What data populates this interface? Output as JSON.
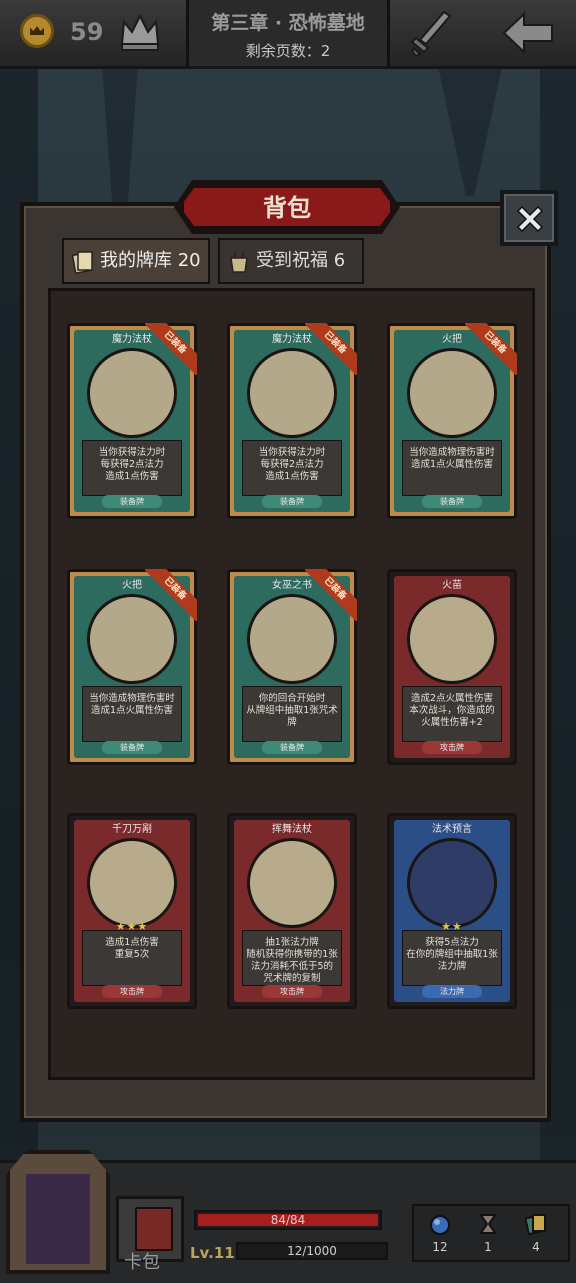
{
  "topbar": {
    "gold": "59",
    "chapter_title": "第三章 · 恐怖墓地",
    "pages_left": "剩余页数：2"
  },
  "modal": {
    "title": "背包",
    "tabs": [
      {
        "label": "我的牌库",
        "count": "20",
        "active": true
      },
      {
        "label": "受到祝福",
        "count": "6",
        "active": false
      }
    ]
  },
  "cards": [
    {
      "name": "魔力法杖",
      "desc": "当你获得法力时\n每获得2点法力\n造成1点伤害",
      "type": "装备牌",
      "equipped": "已装备",
      "color": "green"
    },
    {
      "name": "魔力法杖",
      "desc": "当你获得法力时\n每获得2点法力\n造成1点伤害",
      "type": "装备牌",
      "equipped": "已装备",
      "color": "green"
    },
    {
      "name": "火把",
      "desc": "当你造成物理伤害时\n造成1点火属性伤害",
      "type": "装备牌",
      "equipped": "已装备",
      "color": "green"
    },
    {
      "name": "火把",
      "desc": "当你造成物理伤害时\n造成1点火属性伤害",
      "type": "装备牌",
      "equipped": "已装备",
      "color": "green"
    },
    {
      "name": "女巫之书",
      "desc": "你的回合开始时\n从牌组中抽取1张咒术牌",
      "type": "装备牌",
      "equipped": "已装备",
      "color": "green"
    },
    {
      "name": "火苗",
      "desc": "造成2点火属性伤害\n本次战斗，你造成的\n火属性伤害+2",
      "type": "攻击牌",
      "equipped": "",
      "color": "red"
    },
    {
      "name": "千刀万剐",
      "desc": "造成1点伤害\n重复5次",
      "type": "攻击牌",
      "equipped": "",
      "color": "red",
      "stars": "★★★"
    },
    {
      "name": "挥舞法杖",
      "desc": "抽1张法力牌\n随机获得你携带的1张\n法力消耗不低于5的\n咒术牌的复制",
      "type": "攻击牌",
      "equipped": "",
      "color": "red"
    },
    {
      "name": "法术预言",
      "desc": "获得5点法力\n在你的牌组中抽取1张\n法力牌",
      "type": "法力牌",
      "equipped": "",
      "color": "blue",
      "stars": "★★"
    }
  ],
  "player": {
    "hp": "84/84",
    "hp_fraction": 1.0,
    "level": "Lv.11",
    "xp": "12/1000",
    "xp_fraction": 0.012,
    "deck_label": "卡包"
  },
  "resources": [
    {
      "icon": "mana-orb-icon",
      "value": "12"
    },
    {
      "icon": "hourglass-icon",
      "value": "1"
    },
    {
      "icon": "cards-icon",
      "value": "4"
    }
  ],
  "colors": {
    "accent_red": "#8a1a1a",
    "gold": "#b48a2c",
    "equip_green": "#2c6b5e",
    "attack_red": "#7a2a2a",
    "mana_blue": "#2c4e86"
  }
}
